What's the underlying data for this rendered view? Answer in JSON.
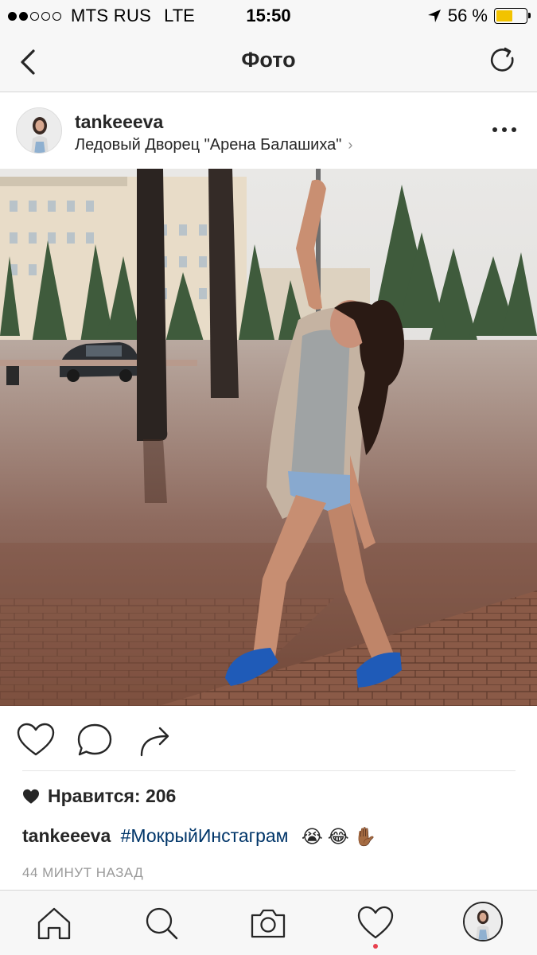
{
  "status_bar": {
    "signal_filled": 2,
    "signal_total": 5,
    "carrier": "MTS RUS",
    "network": "LTE",
    "time": "15:50",
    "battery_percent": "56 %",
    "battery_level": 0.56,
    "battery_color": "#f2c300"
  },
  "nav": {
    "title": "Фото",
    "back_icon": "chevron-left-icon",
    "refresh_icon": "refresh-icon"
  },
  "post": {
    "username": "tankeeeva",
    "location": "Ледовый Дворец \"Арена Балашиха\"",
    "likes_label": "Нравится: 206",
    "caption": {
      "username": "tankeeeva",
      "hashtag": "#МокрыйИнстаграм",
      "emojis": [
        "😭",
        "😂",
        "✋🏾"
      ]
    },
    "timestamp": "44 МИНУТ НАЗАД"
  },
  "actions": [
    "heart-icon",
    "comment-icon",
    "share-icon"
  ],
  "tab_bar": [
    "home-icon",
    "search-icon",
    "camera-icon",
    "activity-heart-icon",
    "profile-avatar"
  ],
  "colors": {
    "hashtag": "#003569",
    "notification_dot": "#e8404e",
    "bar_background": "#f7f7f7"
  }
}
